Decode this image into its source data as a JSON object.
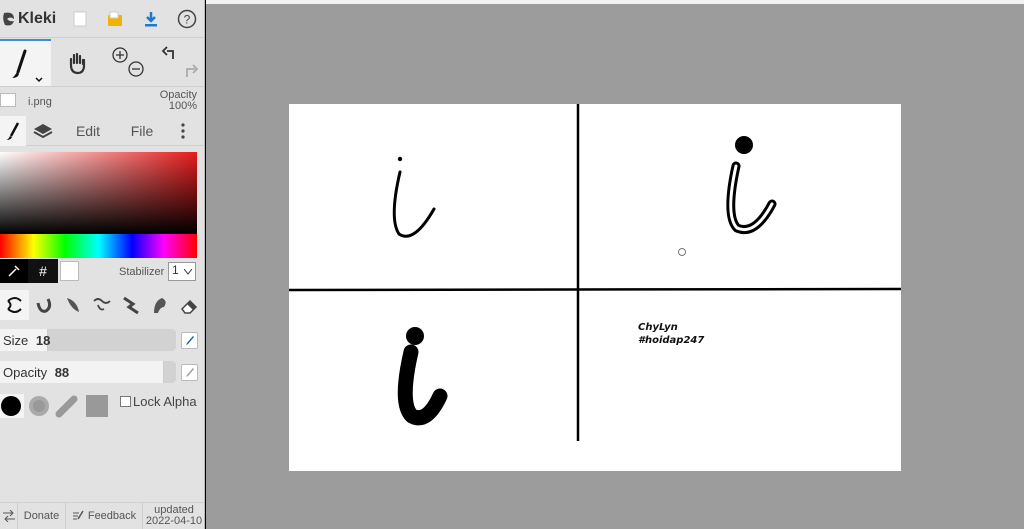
{
  "app": {
    "name": "Kleki"
  },
  "toolbar": {
    "icons": [
      "new-file-icon",
      "open-folder-icon",
      "download-icon",
      "help-icon"
    ]
  },
  "tools": {
    "icons": [
      "brush-tool-icon",
      "hand-tool-icon",
      "zoom-in-icon",
      "zoom-out-icon",
      "undo-icon",
      "redo-icon"
    ]
  },
  "file": {
    "name": "i.png",
    "opacity_label": "Opacity",
    "opacity_value": "100%"
  },
  "tabs": {
    "edit": "Edit",
    "file": "File"
  },
  "color": {
    "hex_label": "#",
    "current": "#ffffff"
  },
  "stabilizer": {
    "label": "Stabilizer",
    "value": "1"
  },
  "brush_settings": {
    "size_label": "Size",
    "size_value": "18",
    "opacity_label": "Opacity",
    "opacity_value": "88",
    "lock_alpha_label": "Lock Alpha"
  },
  "footer": {
    "donate": "Donate",
    "feedback": "Feedback",
    "updated_line1": "updated",
    "updated_line2": "2022-04-10"
  },
  "canvas": {
    "file": "i.png",
    "signature_line1": "ChyLyn",
    "signature_line2": "#hoidap247"
  },
  "colors": {
    "accent": "#3a8be2",
    "workspace": "#9c9c9c",
    "sidebar": "#e2e2e2"
  }
}
